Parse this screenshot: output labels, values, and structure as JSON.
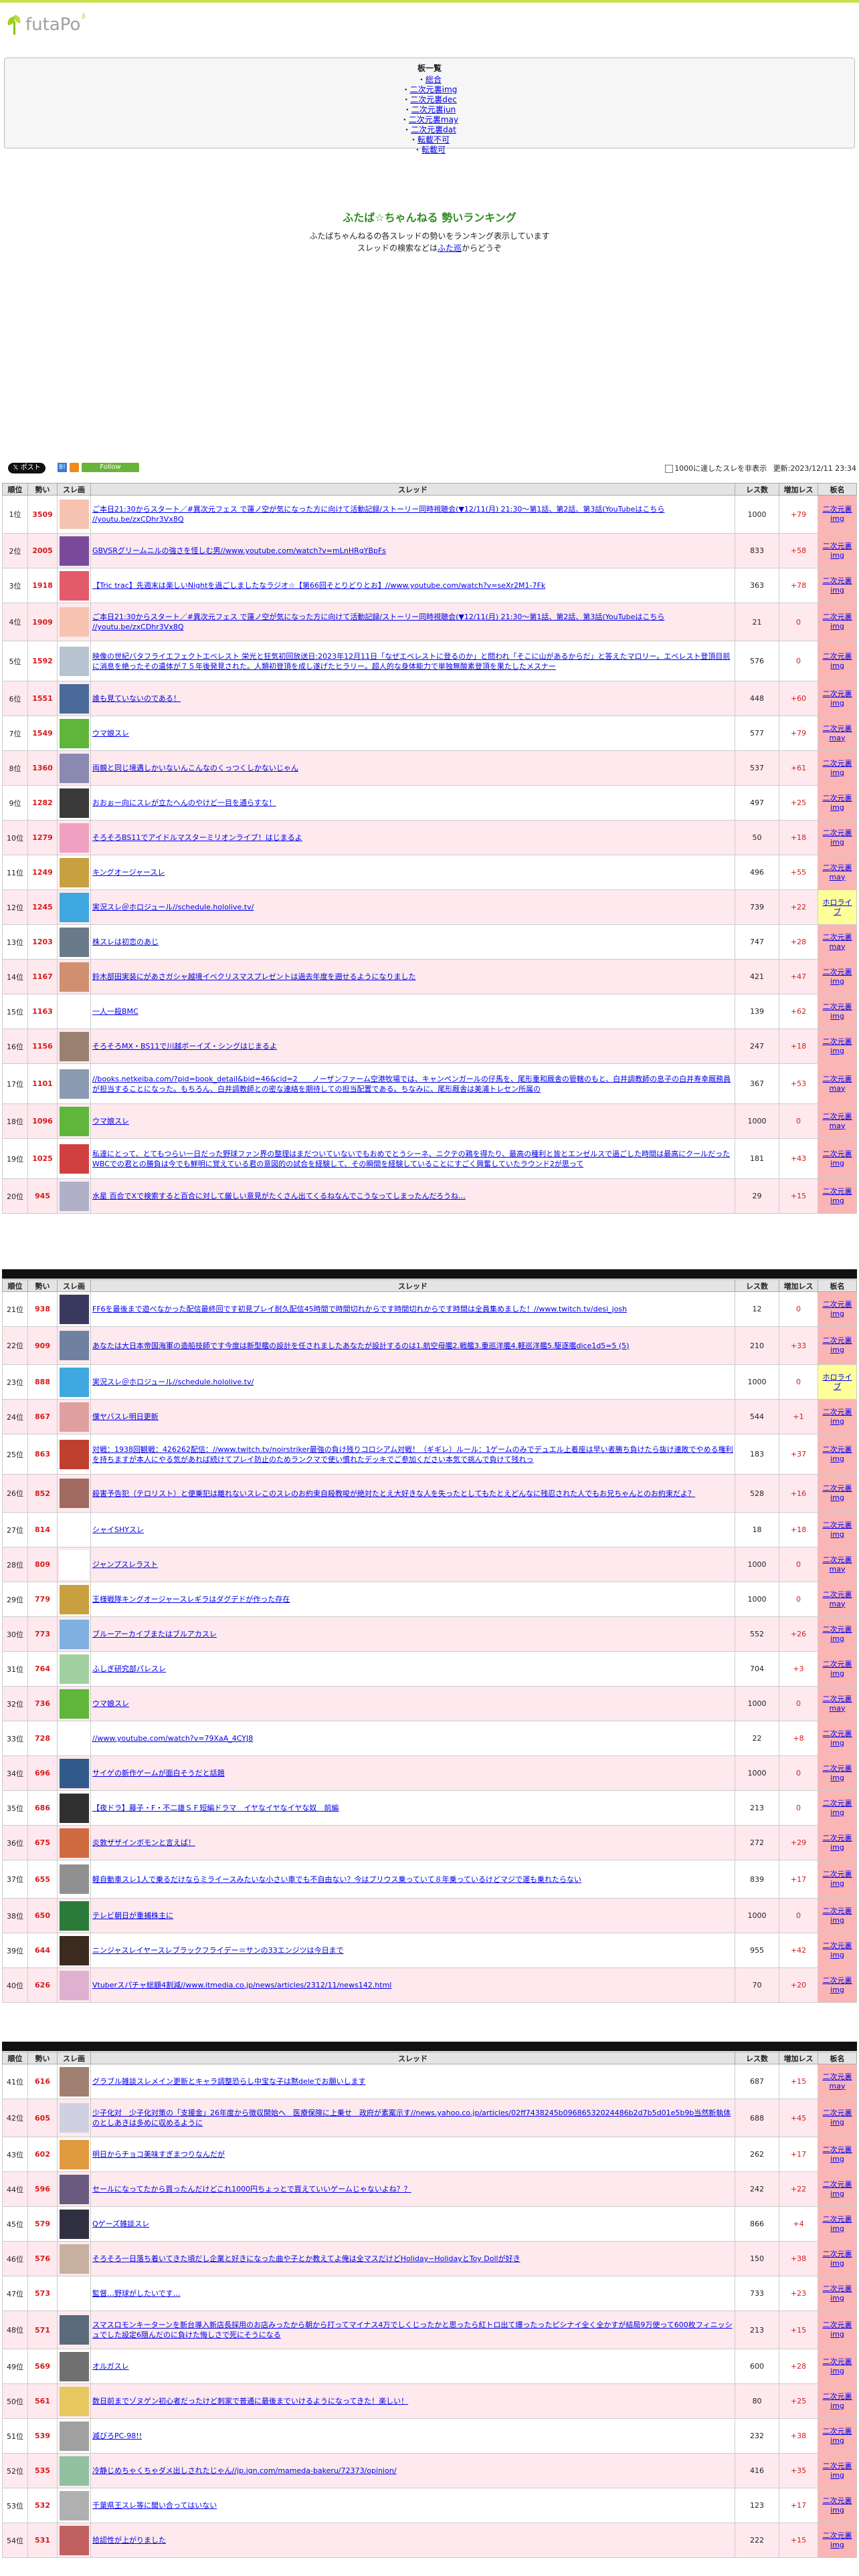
{
  "logo": {
    "name": "futaPo",
    "beta": "β"
  },
  "menu": {
    "title": "板一覧",
    "items": [
      "総合",
      "二次元裏img",
      "二次元裏dec",
      "二次元裏jun",
      "二次元裏may",
      "二次元裏dat",
      "転載不可",
      "転載可"
    ]
  },
  "heading": {
    "title": "ふたば☆ちゃんねる 勢いランキング",
    "desc1": "ふたばちゃんねるの各スレッドの勢いをランキング表示しています",
    "desc2_pre": "スレッドの検索などは",
    "desc2_link": "ふた巡",
    "desc2_post": "からどうぞ"
  },
  "toolbar": {
    "x_label": "ポスト",
    "b_label": "B!",
    "follow_label": "Follow",
    "hide_label": "1000に達したスレを非表示",
    "updated": "更新:2023/12/11 23:34"
  },
  "columns": [
    "順位",
    "勢い",
    "スレ画",
    "スレッド",
    "レス数",
    "増加レス",
    "板名"
  ],
  "rows": [
    {
      "rank": "1位",
      "ikioi": "3509",
      "title": "ご本日21:30からスタート／#異次元フェス で蓮ノ空が気になった方に向けて活動記録/ストーリー同時視聴会(▼12/11(月) 21:30〜第1話、第2話、第3話(YouTubeはこちら //youtu.be/zxCDhr3Vx8Q",
      "res": "1000",
      "inc": "+79",
      "board": "二次元裏img",
      "bc": "img",
      "color": "#f6c3b0",
      "tall": 2
    },
    {
      "rank": "2位",
      "ikioi": "2005",
      "title": "GBVSRグリームニルの強さを怪しむ男//www.youtube.com/watch?v=mLnHRgYBpFs",
      "res": "833",
      "inc": "+58",
      "board": "二次元裏img",
      "bc": "img",
      "color": "#7a4a9a",
      "tall": 1
    },
    {
      "rank": "3位",
      "ikioi": "1918",
      "title": "【Tric trac】先週末は楽しいNightを過ごしましたなラジオ☆【第66回そとりどりとお】//www.youtube.com/watch?v=seXr2M1-7Fk",
      "res": "363",
      "inc": "+78",
      "board": "二次元裏img",
      "bc": "img",
      "color": "#e35a6a",
      "tall": 1
    },
    {
      "rank": "4位",
      "ikioi": "1909",
      "title": "ご本日21:30からスタート／#異次元フェス で蓮ノ空が気になった方に向けて活動記録/ストーリー同時視聴会(▼12/11(月) 21:30〜第1話、第2話、第3話(YouTubeはこちら //youtu.be/zxCDhr3Vx8Q",
      "res": "21",
      "inc": "0",
      "board": "二次元裏img",
      "bc": "img",
      "color": "#f6c3b0",
      "tall": 2
    },
    {
      "rank": "5位",
      "ikioi": "1592",
      "title": "映像の世紀バタフライエフェクトエベレスト 栄光と狂気初回放送日:2023年12月11日「なぜエベレストに登るのか」と問われ「そこに山があるからだ」と答えたマロリー。エベレスト登頂目前に消息を絶ったその遺体が７５年後発見された。人類初登頂を成し遂げたヒラリー。超人的な身体能力で単独無酸素登頂を果たしたメスナー",
      "res": "576",
      "inc": "0",
      "board": "二次元裏img",
      "bc": "img",
      "color": "#b7c4cf",
      "tall": 3
    },
    {
      "rank": "6位",
      "ikioi": "1551",
      "title": "誰も見ていないのである！",
      "res": "448",
      "inc": "+60",
      "board": "二次元裏img",
      "bc": "img",
      "color": "#4a6a9a",
      "tall": 1
    },
    {
      "rank": "7位",
      "ikioi": "1549",
      "title": "ウマ娘スレ",
      "res": "577",
      "inc": "+79",
      "board": "二次元裏may",
      "bc": "may",
      "color": "#5fb63a",
      "tall": 1
    },
    {
      "rank": "8位",
      "ikioi": "1360",
      "title": "両親と同じ境遇しかいないんこんなのくっつくしかないじゃん",
      "res": "537",
      "inc": "+61",
      "board": "二次元裏img",
      "bc": "img",
      "color": "#8a8ab0",
      "tall": 1
    },
    {
      "rank": "9位",
      "ikioi": "1282",
      "title": "おおぉー向にスレが立たへんのやけど一目を通らすな！",
      "res": "497",
      "inc": "+25",
      "board": "二次元裏img",
      "bc": "img",
      "color": "#3a3a3a",
      "tall": 1
    },
    {
      "rank": "10位",
      "ikioi": "1279",
      "title": "そろそろBS11でアイドルマスターミリオンライブ！はじまるよ",
      "res": "50",
      "inc": "+18",
      "board": "二次元裏img",
      "bc": "img",
      "color": "#f0a0c0",
      "tall": 1
    },
    {
      "rank": "11位",
      "ikioi": "1249",
      "title": "キングオージャースレ",
      "res": "496",
      "inc": "+55",
      "board": "二次元裏may",
      "bc": "may",
      "color": "#c8a040",
      "tall": 1
    },
    {
      "rank": "12位",
      "ikioi": "1245",
      "title": "実況スレ＠ホロジュール//schedule.hololive.tv/",
      "res": "739",
      "inc": "+22",
      "board": "ホロライブ",
      "bc": "hol",
      "color": "#40a8e0",
      "tall": 1
    },
    {
      "rank": "13位",
      "ikioi": "1203",
      "title": "株スレは初恋のあじ",
      "res": "747",
      "inc": "+28",
      "board": "二次元裏may",
      "bc": "may",
      "color": "#6a7a8a",
      "tall": 1
    },
    {
      "rank": "14位",
      "ikioi": "1167",
      "title": "鈴木部田実装にがあさガシャ越境イベクリスマスプレゼントは過去年度を遡せるようになりました",
      "res": "421",
      "inc": "+47",
      "board": "二次元裏img",
      "bc": "img",
      "color": "#d09070",
      "tall": 1
    },
    {
      "rank": "15位",
      "ikioi": "1163",
      "title": "一人一殺BMC",
      "res": "139",
      "inc": "+62",
      "board": "二次元裏img",
      "bc": "img",
      "color": "#ffffff",
      "tall": 1
    },
    {
      "rank": "16位",
      "ikioi": "1156",
      "title": "そろそろMX・BS11で川越ボーイズ・シングはじまるよ",
      "res": "247",
      "inc": "+18",
      "board": "二次元裏img",
      "bc": "img",
      "color": "#9a8070",
      "tall": 1
    },
    {
      "rank": "17位",
      "ikioi": "1101",
      "title": "//books.netkeiba.com/?pid=book_detail&bid=46&cid=2　　ノーザンファーム空港牧場では、キャンペンガールの仔馬を、尾形重和厩舎の管轄のもと、白井調教師の息子の白井寿幸厩務員が担当することになった。もちろん、白井調教師との密な連絡を期待しての担当配置である。ちなみに、尾形厩舎は美浦トレセン所属の",
      "res": "367",
      "inc": "+53",
      "board": "二次元裏may",
      "bc": "may",
      "color": "#8a9ab0",
      "tall": 3
    },
    {
      "rank": "18位",
      "ikioi": "1096",
      "title": "ウマ娘スレ",
      "res": "1000",
      "inc": "0",
      "board": "二次元裏may",
      "bc": "may",
      "color": "#5fb63a",
      "tall": 1
    },
    {
      "rank": "19位",
      "ikioi": "1025",
      "title": "私達にとって、とてもつらい一日だった野球ファン界の整理はまだついていないでもおめでとうシーネ、ニクテの鶏を得たり、最高の種利と皆とエンゼルスで過ごした時間は最高にクールだったWBCでの君との勝負は今でも鮮明に覚えている君の意図的の試合を経験して、その瞬間を経験していることにすごく興奮していたラウンド2が思って",
      "res": "181",
      "inc": "+43",
      "board": "二次元裏img",
      "bc": "img",
      "color": "#d04040",
      "tall": 3
    },
    {
      "rank": "20位",
      "ikioi": "945",
      "title": "水星 百合でXで検索すると百合に対して厳しい意見がたくさん出てくるねなんでこうなってしまったんだろうね…",
      "res": "29",
      "inc": "+15",
      "board": "二次元裏img",
      "bc": "img",
      "color": "#b0b0c8",
      "tall": 1
    }
  ],
  "rows2": [
    {
      "rank": "21位",
      "ikioi": "938",
      "title": "FF6を最後まで遊べなかった配信最終回です初見プレイ耐久配信45時間で時間切れからです時間切れからです時間は全員集めました！//www.twitch.tv/desi_josh",
      "res": "12",
      "inc": "0",
      "board": "二次元裏img",
      "bc": "img",
      "color": "#3a3a60",
      "tall": 1
    },
    {
      "rank": "22位",
      "ikioi": "909",
      "title": "あなたは大日本帝国海軍の造船技師です今度は新型艦の設計を任されましたあなたが設計するのは1.航空母艦2.戦艦3.重巡洋艦4.軽巡洋艦5.駆逐艦dice1d5=5 (5)",
      "res": "210",
      "inc": "+33",
      "board": "二次元裏img",
      "bc": "img",
      "color": "#7080a0",
      "tall": 2
    },
    {
      "rank": "23位",
      "ikioi": "888",
      "title": "実況スレ＠ホロジュール//schedule.hololive.tv/",
      "res": "1000",
      "inc": "0",
      "board": "ホロライブ",
      "bc": "hol",
      "color": "#40a8e0",
      "tall": 1
    },
    {
      "rank": "24位",
      "ikioi": "867",
      "title": "僕ヤバスレ明日更新",
      "res": "544",
      "inc": "+1",
      "board": "二次元裏img",
      "bc": "img",
      "color": "#e0a0a0",
      "tall": 1
    },
    {
      "rank": "25位",
      "ikioi": "863",
      "title": "対戦：1938回観戦：426262配信：//www.twitch.tv/noirstriker最強の負け残りコロシアム対戦！（ギギレ）ルール：1ゲームのみでデュエル上着座は早い者勝ち負けたら抜け連敗でやめる権利を持ちますが本人にやる気があれば続けてプレイ防止のためランクマで使い慣れたデッキでご参加ください本気で挑んで負けて残れっ",
      "res": "183",
      "inc": "+37",
      "board": "二次元裏img",
      "bc": "img",
      "color": "#c04030",
      "tall": 3
    },
    {
      "rank": "26位",
      "ikioi": "852",
      "title": "殺害予告犯（テロリスト）と便乗犯は離れないスレこのスレのお約束自殺教唆が絶対たとえ大好きな人を失ったとしてもたとえどんなに残忍された人でもお兄ちゃんとのお約束だよ？",
      "res": "528",
      "inc": "+16",
      "board": "二次元裏img",
      "bc": "img",
      "color": "#a06a60",
      "tall": 2
    },
    {
      "rank": "27位",
      "ikioi": "814",
      "title": "シャイSHYスレ",
      "res": "18",
      "inc": "+18",
      "board": "二次元裏img",
      "bc": "img",
      "color": "#ffffff",
      "tall": 1
    },
    {
      "rank": "28位",
      "ikioi": "809",
      "title": "ジャンプスレラスト",
      "res": "1000",
      "inc": "0",
      "board": "二次元裏may",
      "bc": "may",
      "color": "#ffffff",
      "tall": 1
    },
    {
      "rank": "29位",
      "ikioi": "779",
      "title": "王様戦隊キングオージャースレギラはダグデドが作った存在",
      "res": "1000",
      "inc": "0",
      "board": "二次元裏may",
      "bc": "may",
      "color": "#c8a040",
      "tall": 1
    },
    {
      "rank": "30位",
      "ikioi": "773",
      "title": "ブルーアーカイブまたはブルアカスレ",
      "res": "552",
      "inc": "+26",
      "board": "二次元裏img",
      "bc": "img",
      "color": "#80b0e0",
      "tall": 1
    },
    {
      "rank": "31位",
      "ikioi": "764",
      "title": "ふしぎ研究部パレスレ",
      "res": "704",
      "inc": "+3",
      "board": "二次元裏img",
      "bc": "img",
      "color": "#a0d0a0",
      "tall": 1
    },
    {
      "rank": "32位",
      "ikioi": "736",
      "title": "ウマ娘スレ",
      "res": "1000",
      "inc": "0",
      "board": "二次元裏may",
      "bc": "may",
      "color": "#5fb63a",
      "tall": 1
    },
    {
      "rank": "33位",
      "ikioi": "728",
      "title": "//www.youtube.com/watch?v=79XaA_4CYJ8",
      "res": "22",
      "inc": "+8",
      "board": "二次元裏img",
      "bc": "img",
      "color": "#ffffff",
      "tall": 1
    },
    {
      "rank": "34位",
      "ikioi": "696",
      "title": "サイゲの新作ゲームが面白そうだと話題",
      "res": "1000",
      "inc": "0",
      "board": "二次元裏img",
      "bc": "img",
      "color": "#305a8a",
      "tall": 1
    },
    {
      "rank": "35位",
      "ikioi": "686",
      "title": "【夜ドラ】藤子・F・不二雄ＳＦ短編ドラマ　イヤなイヤなイヤな奴　前編",
      "res": "213",
      "inc": "0",
      "board": "二次元裏img",
      "bc": "img",
      "color": "#303030",
      "tall": 1
    },
    {
      "rank": "36位",
      "ikioi": "675",
      "title": "炎敦ザザインボモンと言えば！",
      "res": "272",
      "inc": "+29",
      "board": "二次元裏img",
      "bc": "img",
      "color": "#d06a40",
      "tall": 1
    },
    {
      "rank": "37位",
      "ikioi": "655",
      "title": "軽自動車スレ1人で乗るだけならミライースみたいな小さい車でも不自由ない？今はプリウス乗っていて８年乗っているけどマジで運も乗れたらない",
      "res": "839",
      "inc": "+17",
      "board": "二次元裏img",
      "bc": "img",
      "color": "#909090",
      "tall": 2
    },
    {
      "rank": "38位",
      "ikioi": "650",
      "title": "テレビ朝日が重捕株主に",
      "res": "1000",
      "inc": "0",
      "board": "二次元裏img",
      "bc": "img",
      "color": "#2a7a3a",
      "tall": 1
    },
    {
      "rank": "39位",
      "ikioi": "644",
      "title": "ニンジャスレイヤースレブラックフライデー＝サンの33エンジツは今日まで",
      "res": "955",
      "inc": "+42",
      "board": "二次元裏img",
      "bc": "img",
      "color": "#3a2a20",
      "tall": 1
    },
    {
      "rank": "40位",
      "ikioi": "626",
      "title": "Vtuberスパチャ総額4割減//www.itmedia.co.jp/news/articles/2312/11/news142.html",
      "res": "70",
      "inc": "+20",
      "board": "二次元裏img",
      "bc": "img",
      "color": "#e0b0d0",
      "tall": 1
    }
  ],
  "rows3": [
    {
      "rank": "41位",
      "ikioi": "616",
      "title": "グラブル雑談スレメイン更新とキャラ調整恐らし中宝な子は黙deleでお願いします",
      "res": "687",
      "inc": "+15",
      "board": "二次元裏may",
      "bc": "may",
      "color": "#a08070",
      "tall": 1
    },
    {
      "rank": "42位",
      "ikioi": "605",
      "title": "少子化対　少子化対策の「支援金」26年度から徴収開始へ　医療保険に上乗せ　政府が素案示す//news.yahoo.co.jp/articles/02ff7438245b09686532024486b2d7b5d01e5b9b当然新執体のとしあきは多めに収めるように",
      "res": "688",
      "inc": "+45",
      "board": "二次元裏img",
      "bc": "img",
      "color": "#d0d0e0",
      "tall": 2
    },
    {
      "rank": "43位",
      "ikioi": "602",
      "title": "明日からチョコ美味すぎまつりなんだが",
      "res": "262",
      "inc": "+17",
      "board": "二次元裏img",
      "bc": "img",
      "color": "#e09a40",
      "tall": 1
    },
    {
      "rank": "44位",
      "ikioi": "596",
      "title": "セールになってたから買ったんだけどこれ1000円ちょっとで買えていいゲームじゃないよね？？",
      "res": "242",
      "inc": "+22",
      "board": "二次元裏img",
      "bc": "img",
      "color": "#6a5a80",
      "tall": 1
    },
    {
      "rank": "45位",
      "ikioi": "579",
      "title": "Qゲーズ雑談スレ",
      "res": "866",
      "inc": "+4",
      "board": "二次元裏img",
      "bc": "img",
      "color": "#303040",
      "tall": 1
    },
    {
      "rank": "46位",
      "ikioi": "576",
      "title": "そろそろ一日落ち着いてきた頃だし企業と好きになった曲や子とか教えてよ俺は全マスだけどHoliday∽HolidayとToy Dollが好き",
      "res": "150",
      "inc": "+38",
      "board": "二次元裏img",
      "bc": "img",
      "color": "#c8b0a0",
      "tall": 1
    },
    {
      "rank": "47位",
      "ikioi": "573",
      "title": "監督…野球がしたいです…",
      "res": "733",
      "inc": "+23",
      "board": "二次元裏img",
      "bc": "img",
      "color": "#ffffff",
      "tall": 1
    },
    {
      "rank": "48位",
      "ikioi": "571",
      "title": "スマスロモンキーターンを新台導入新店長採用のお店みったから朝から打ってマイナス4万でしくじったかと思ったら紅トロ出て爆ったったピシナイ全く全かすが結局9万使って600枚フィニッシュでした設定6隠んだのに負けた悔しさで死にそうになる",
      "res": "213",
      "inc": "+15",
      "board": "二次元裏img",
      "bc": "img",
      "color": "#5a6a7a",
      "tall": 2
    },
    {
      "rank": "49位",
      "ikioi": "569",
      "title": "オルガスレ",
      "res": "600",
      "inc": "+28",
      "board": "二次元裏img",
      "bc": "img",
      "color": "#707070",
      "tall": 1
    },
    {
      "rank": "50位",
      "ikioi": "561",
      "title": "数日前までゾヌゲン初心者だったけど刺家で普通に最後までいけるようになってきた！楽しい！",
      "res": "80",
      "inc": "+25",
      "board": "二次元裏img",
      "bc": "img",
      "color": "#e8c860",
      "tall": 1
    },
    {
      "rank": "51位",
      "ikioi": "539",
      "title": "滅びろPC-98!!",
      "res": "232",
      "inc": "+38",
      "board": "二次元裏img",
      "bc": "img",
      "color": "#a0a0a0",
      "tall": 1
    },
    {
      "rank": "52位",
      "ikioi": "535",
      "title": "冷静じめちゃくちゃダメ出しされたじゃん//jp.ign.com/mameda-bakeru/72373/opinion/",
      "res": "416",
      "inc": "+35",
      "board": "二次元裏img",
      "bc": "img",
      "color": "#90c0a0",
      "tall": 1
    },
    {
      "rank": "53位",
      "ikioi": "532",
      "title": "千葉県王スレ等に聞い合ってはいない",
      "res": "123",
      "inc": "+17",
      "board": "二次元裏img",
      "bc": "img",
      "color": "#b0b0b0",
      "tall": 1
    },
    {
      "rank": "54位",
      "ikioi": "531",
      "title": "拾認性が上がりました",
      "res": "222",
      "inc": "+15",
      "board": "二次元裏img",
      "bc": "img",
      "color": "#c06060",
      "tall": 1
    }
  ]
}
